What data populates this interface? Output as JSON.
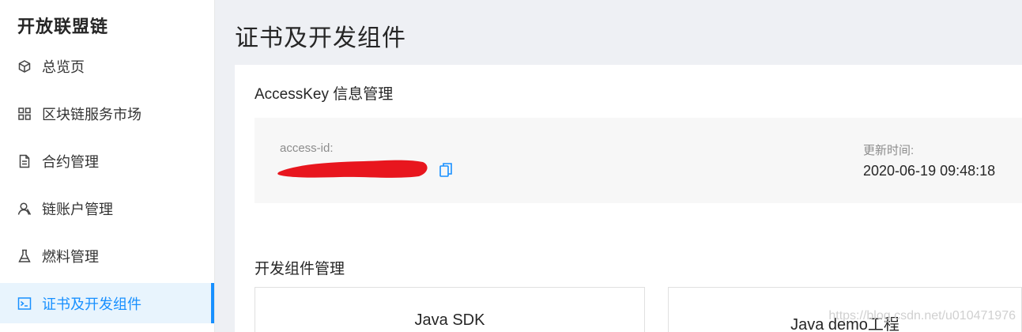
{
  "sidebar": {
    "brand": "开放联盟链",
    "items": [
      {
        "label": "总览页",
        "icon": "cube-icon"
      },
      {
        "label": "区块链服务市场",
        "icon": "grid-icon"
      },
      {
        "label": "合约管理",
        "icon": "document-icon"
      },
      {
        "label": "链账户管理",
        "icon": "user-icon"
      },
      {
        "label": "燃料管理",
        "icon": "flask-icon"
      },
      {
        "label": "证书及开发组件",
        "icon": "terminal-icon",
        "active": true
      }
    ]
  },
  "main": {
    "title": "证书及开发组件",
    "accesskey": {
      "section_title": "AccessKey 信息管理",
      "access_id_label": "access-id:",
      "updated_label": "更新时间:",
      "updated_value": "2020-06-19 09:48:18"
    },
    "components": {
      "section_title": "开发组件管理",
      "cards": [
        {
          "label": "Java SDK"
        },
        {
          "label": "Java demo工程"
        }
      ]
    }
  },
  "watermark": "https://blog.csdn.net/u010471976",
  "colors": {
    "accent": "#1890ff",
    "active_bg": "#e8f4fd",
    "main_bg": "#eef0f4",
    "panel_bg": "#f7f7f7",
    "redaction": "#e8161e"
  }
}
